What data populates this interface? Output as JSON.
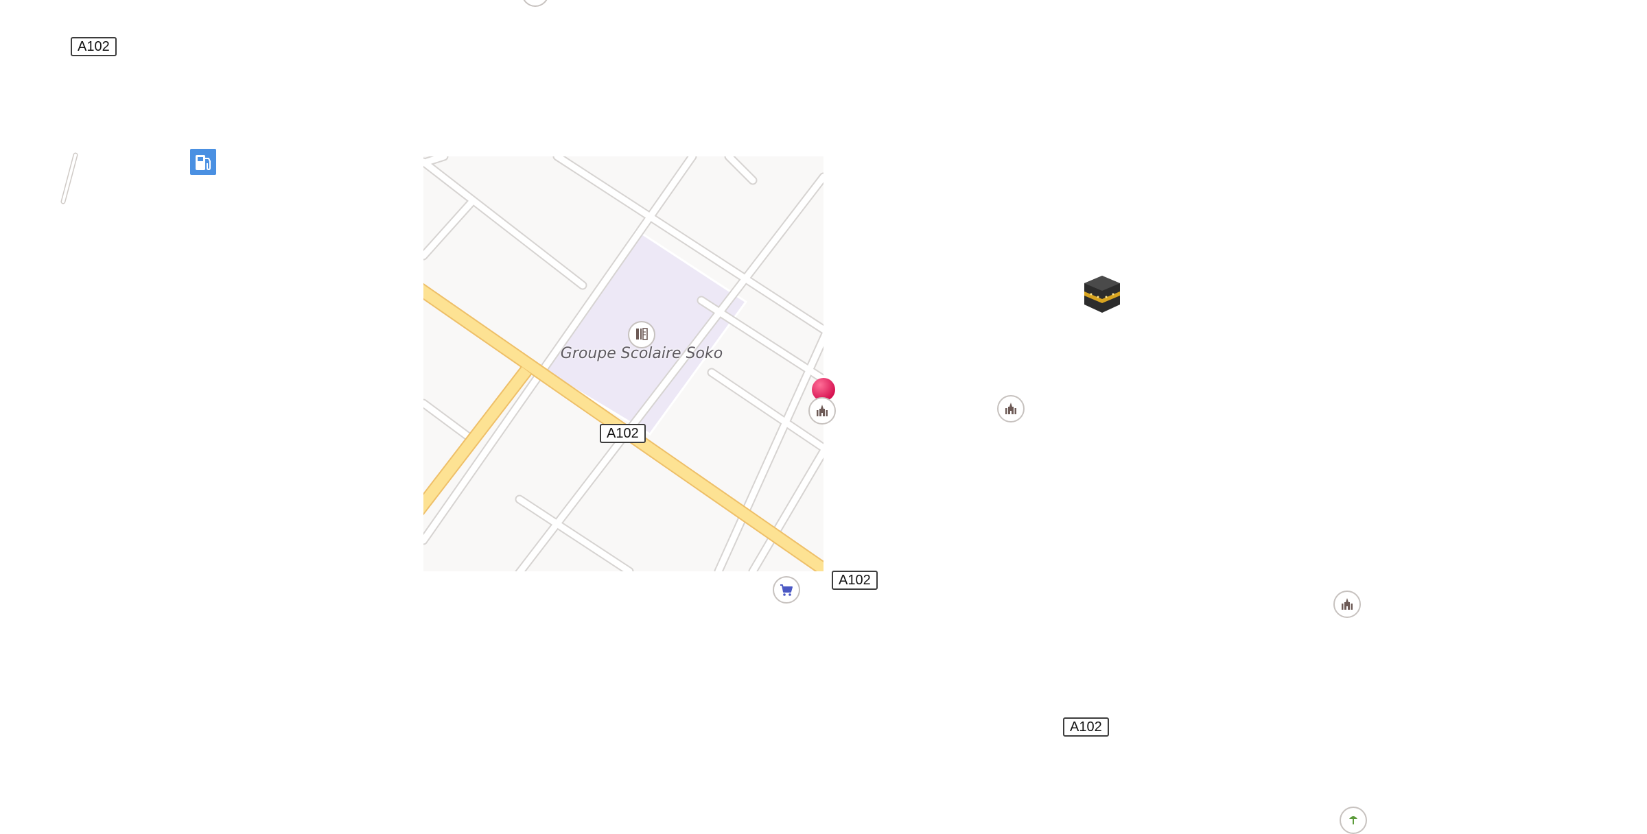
{
  "map": {
    "route_shields": [
      {
        "id": "nw",
        "text": "A102"
      },
      {
        "id": "center",
        "text": "A102"
      },
      {
        "id": "east",
        "text": "A102"
      },
      {
        "id": "south",
        "text": "A102"
      }
    ],
    "area_label": "Groupe Scolaire Soko",
    "colors": {
      "background": "#ffffff",
      "tile_land": "#f9f8f7",
      "school_area": "#ede8f6",
      "road_major": "#fde293",
      "road_major_edge": "#eebf68",
      "road_minor": "#ffffff",
      "road_minor_edge": "#d6d3d1",
      "poi_icon": "#6d5a56",
      "fuel": "#4a90e2",
      "shop": "#4a58c4",
      "pin": "#e8175d"
    },
    "pois": [
      {
        "name": "school-icon",
        "category": "education"
      },
      {
        "name": "mosque-icon",
        "category": "religious"
      },
      {
        "name": "mosque-icon",
        "category": "religious"
      },
      {
        "name": "mosque-icon",
        "category": "religious"
      },
      {
        "name": "shopping-cart-icon",
        "category": "shop"
      },
      {
        "name": "fuel-station-icon",
        "category": "fuel"
      },
      {
        "name": "kaaba-icon",
        "category": "religious"
      },
      {
        "name": "park-icon",
        "category": "leisure"
      }
    ]
  }
}
